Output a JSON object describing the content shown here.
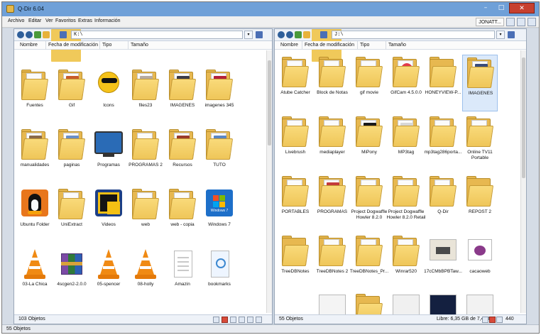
{
  "window": {
    "title": "Q-Dir 6.04",
    "buttons": {
      "minimize": "–",
      "maximize": "□",
      "close": "✕"
    }
  },
  "menu": {
    "items": [
      "Archivo",
      "Editar",
      "Ver",
      "Favoritos",
      "Extras",
      "Información"
    ],
    "user": "JONATT..."
  },
  "left_pane": {
    "address": "K:\\",
    "columns": [
      "Nombre",
      "Fecha de modificación",
      "Tipo",
      "Tamaño"
    ],
    "items": [
      "Fuentes",
      "Gif",
      "Icons",
      "files23",
      "IMAGENES",
      "imagenes 345",
      "manualidades",
      "paginas",
      "Programas",
      "PROGRAMAS 2",
      "Recursos",
      "TUTO",
      "Ubuntu Folder",
      "UniExtract",
      "Videos",
      "web",
      "web - copia",
      "Windows 7",
      "03-La Chica",
      "4scgen2-2.0.0",
      "05-spencer",
      "08-holly",
      "Amazin",
      "bookmarks"
    ],
    "status_count": "103 Objetos"
  },
  "right_pane": {
    "address": "J:\\",
    "columns": [
      "Nombre",
      "Fecha de modificación",
      "Tipo",
      "Tamaño"
    ],
    "items": [
      "Atube Catcher",
      "Block de Notas",
      "gif movie",
      "GifCam 4.5.0.0",
      "HONEYVIEW-P...",
      "IMAGENES",
      "Livebrush",
      "mediaplayer",
      "MiPony",
      "MP3tag",
      "mp3tag286porta...",
      "Online TV11 Portable",
      "PORTABLES",
      "PROGRAMAS",
      "Project Dogwaffle Howler 8.2.0",
      "Project Dogwaffle Howler 8.2.0 Retail",
      "Q-Dir",
      "REPOST 2",
      "TreeDBNotes",
      "TreeDBNotes 2",
      "TreeDBNotes_Pr...",
      "Winrar520",
      "17cCMbBPBTaw...",
      "cacaoweb"
    ],
    "status_count": "55 Objetos",
    "free_space": "Libre: 6,35 GB de 7,43 GB",
    "size_value": "440"
  },
  "statusbar": {
    "text": "55 Objetos"
  },
  "colors": {
    "title_bar": "#6fa0d8",
    "folder": "#efc659",
    "selection": "#dbe9fa",
    "close_button": "#c7402f"
  }
}
